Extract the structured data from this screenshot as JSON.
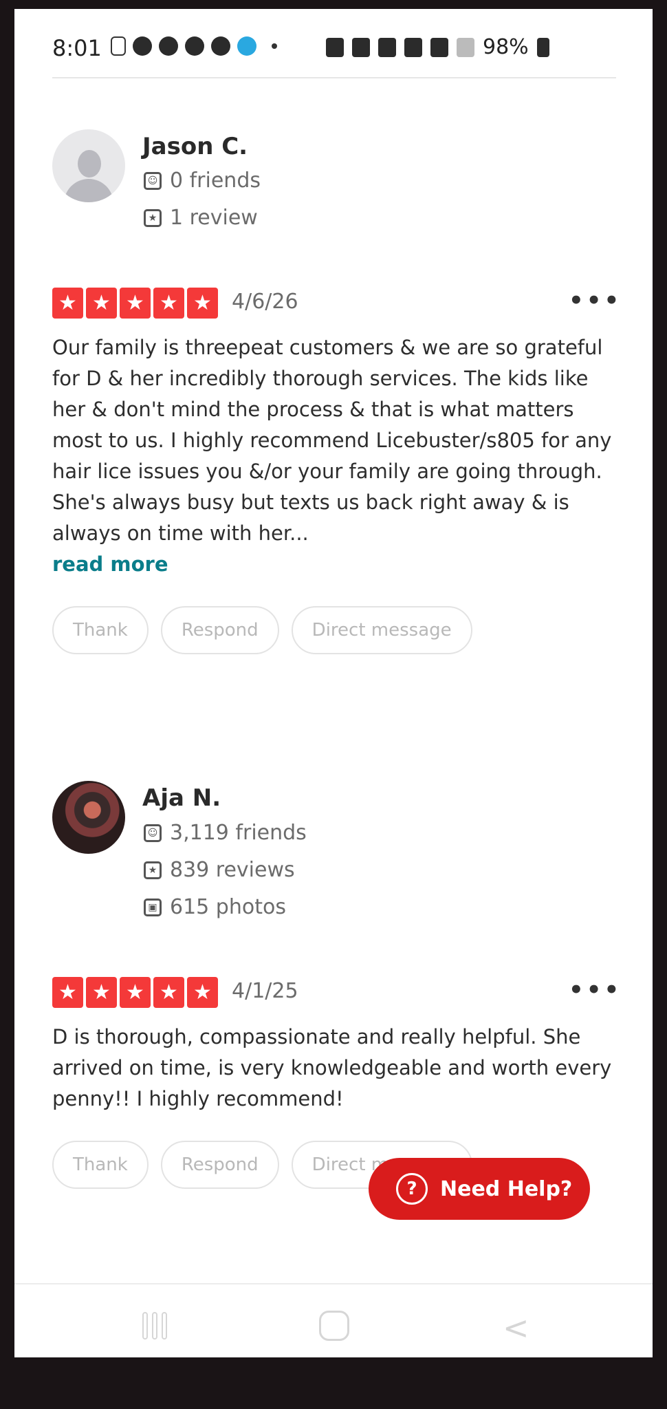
{
  "status_bar": {
    "time": "8:01",
    "battery": "98%",
    "icons": [
      "message-icon",
      "messenger-icon",
      "instagram-icon",
      "news-icon",
      "news-icon",
      "location-icon",
      "nfc-icon",
      "alarm-icon",
      "mute-icon",
      "lte-icon",
      "signal-icon",
      "battery-icon"
    ]
  },
  "reviews": [
    {
      "name": "Jason C.",
      "friends": "0 friends",
      "reviews": "1 review",
      "rating": 5,
      "date": "4/6/26",
      "text": "Our family is threepeat customers & we are so grateful for D & her incredibly thorough services. The kids like her & don't mind the process & that is what matters most to us. I highly recommend Licebuster/s805 for any hair lice issues you &/or your family are going through. She's always busy but texts us back right away & is always on time with her...",
      "read_more": "read more",
      "actions": [
        "Thank",
        "Respond",
        "Direct message"
      ]
    },
    {
      "name": "Aja N.",
      "friends": "3,119 friends",
      "reviews": "839 reviews",
      "photos": "615 photos",
      "rating": 5,
      "date": "4/1/25",
      "text": "D is thorough, compassionate and really helpful. She arrived on time, is very knowledgeable and worth every penny!! I highly recommend!",
      "actions": [
        "Thank",
        "Respond",
        "Direct message"
      ]
    }
  ],
  "help_button": "Need Help?",
  "more_label": "•••"
}
